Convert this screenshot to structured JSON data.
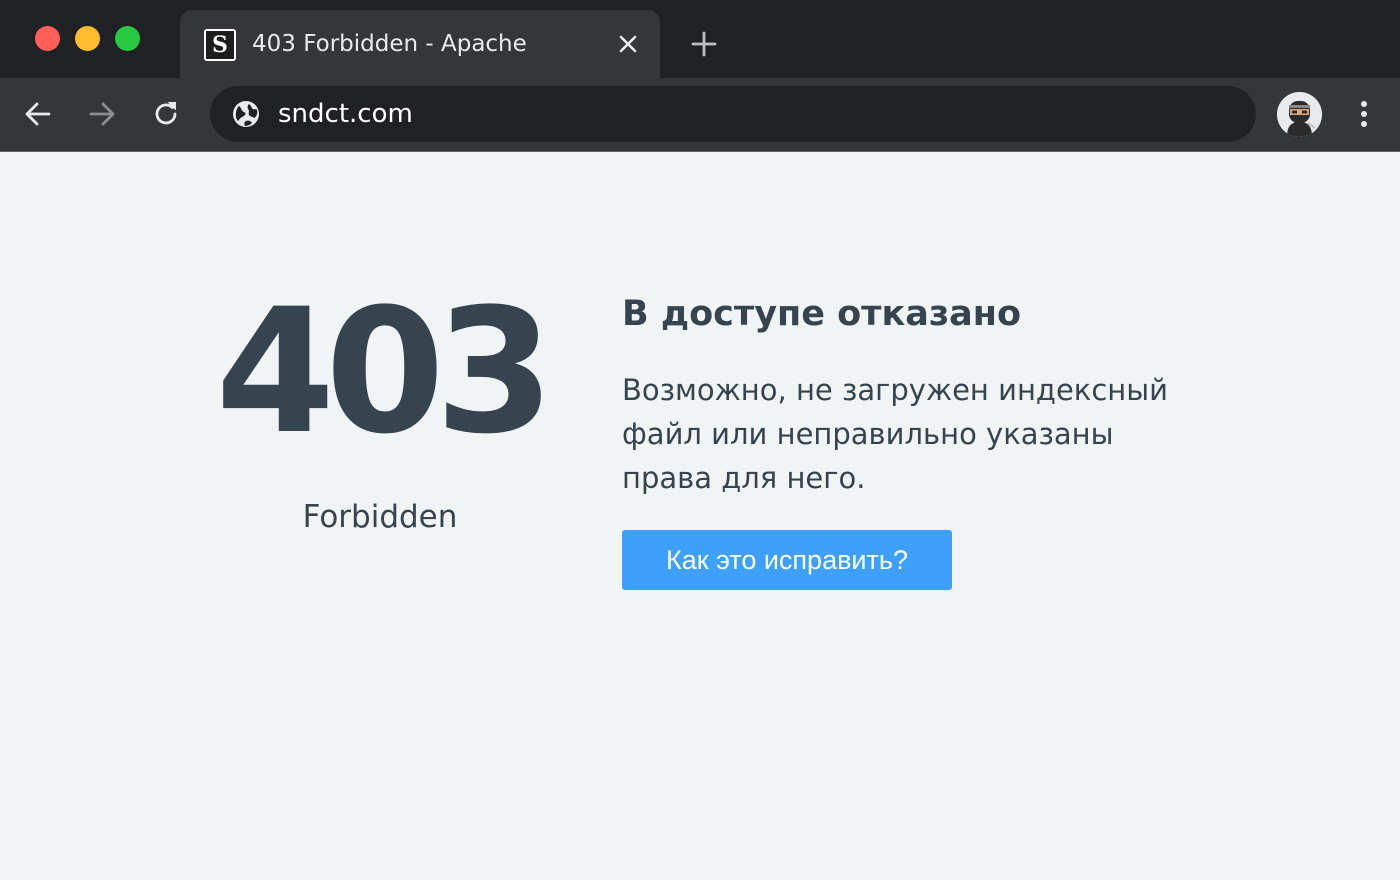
{
  "browser": {
    "tab": {
      "favicon_letter": "S",
      "title": "403 Forbidden - Apache"
    },
    "address_bar": {
      "url": "sndct.com"
    },
    "icons": {
      "close": "close-icon",
      "new_tab": "plus-icon",
      "back": "arrow-left-icon",
      "forward": "arrow-right-icon",
      "reload": "reload-icon",
      "site_info": "globe-icon",
      "profile": "avatar",
      "menu": "kebab-menu-icon"
    }
  },
  "page": {
    "error_code": "403",
    "error_label": "Forbidden",
    "heading": "В доступе отказано",
    "description": "Возможно, не загружен индексный файл или неправильно указаны права для него.",
    "fix_button_label": "Как это исправить?"
  },
  "colors": {
    "text": "#364450",
    "background": "#f1f4f5",
    "button": "#3ea0fb",
    "traffic_red": "#fe5f57",
    "traffic_yellow": "#febc2e",
    "traffic_green": "#28c840"
  }
}
